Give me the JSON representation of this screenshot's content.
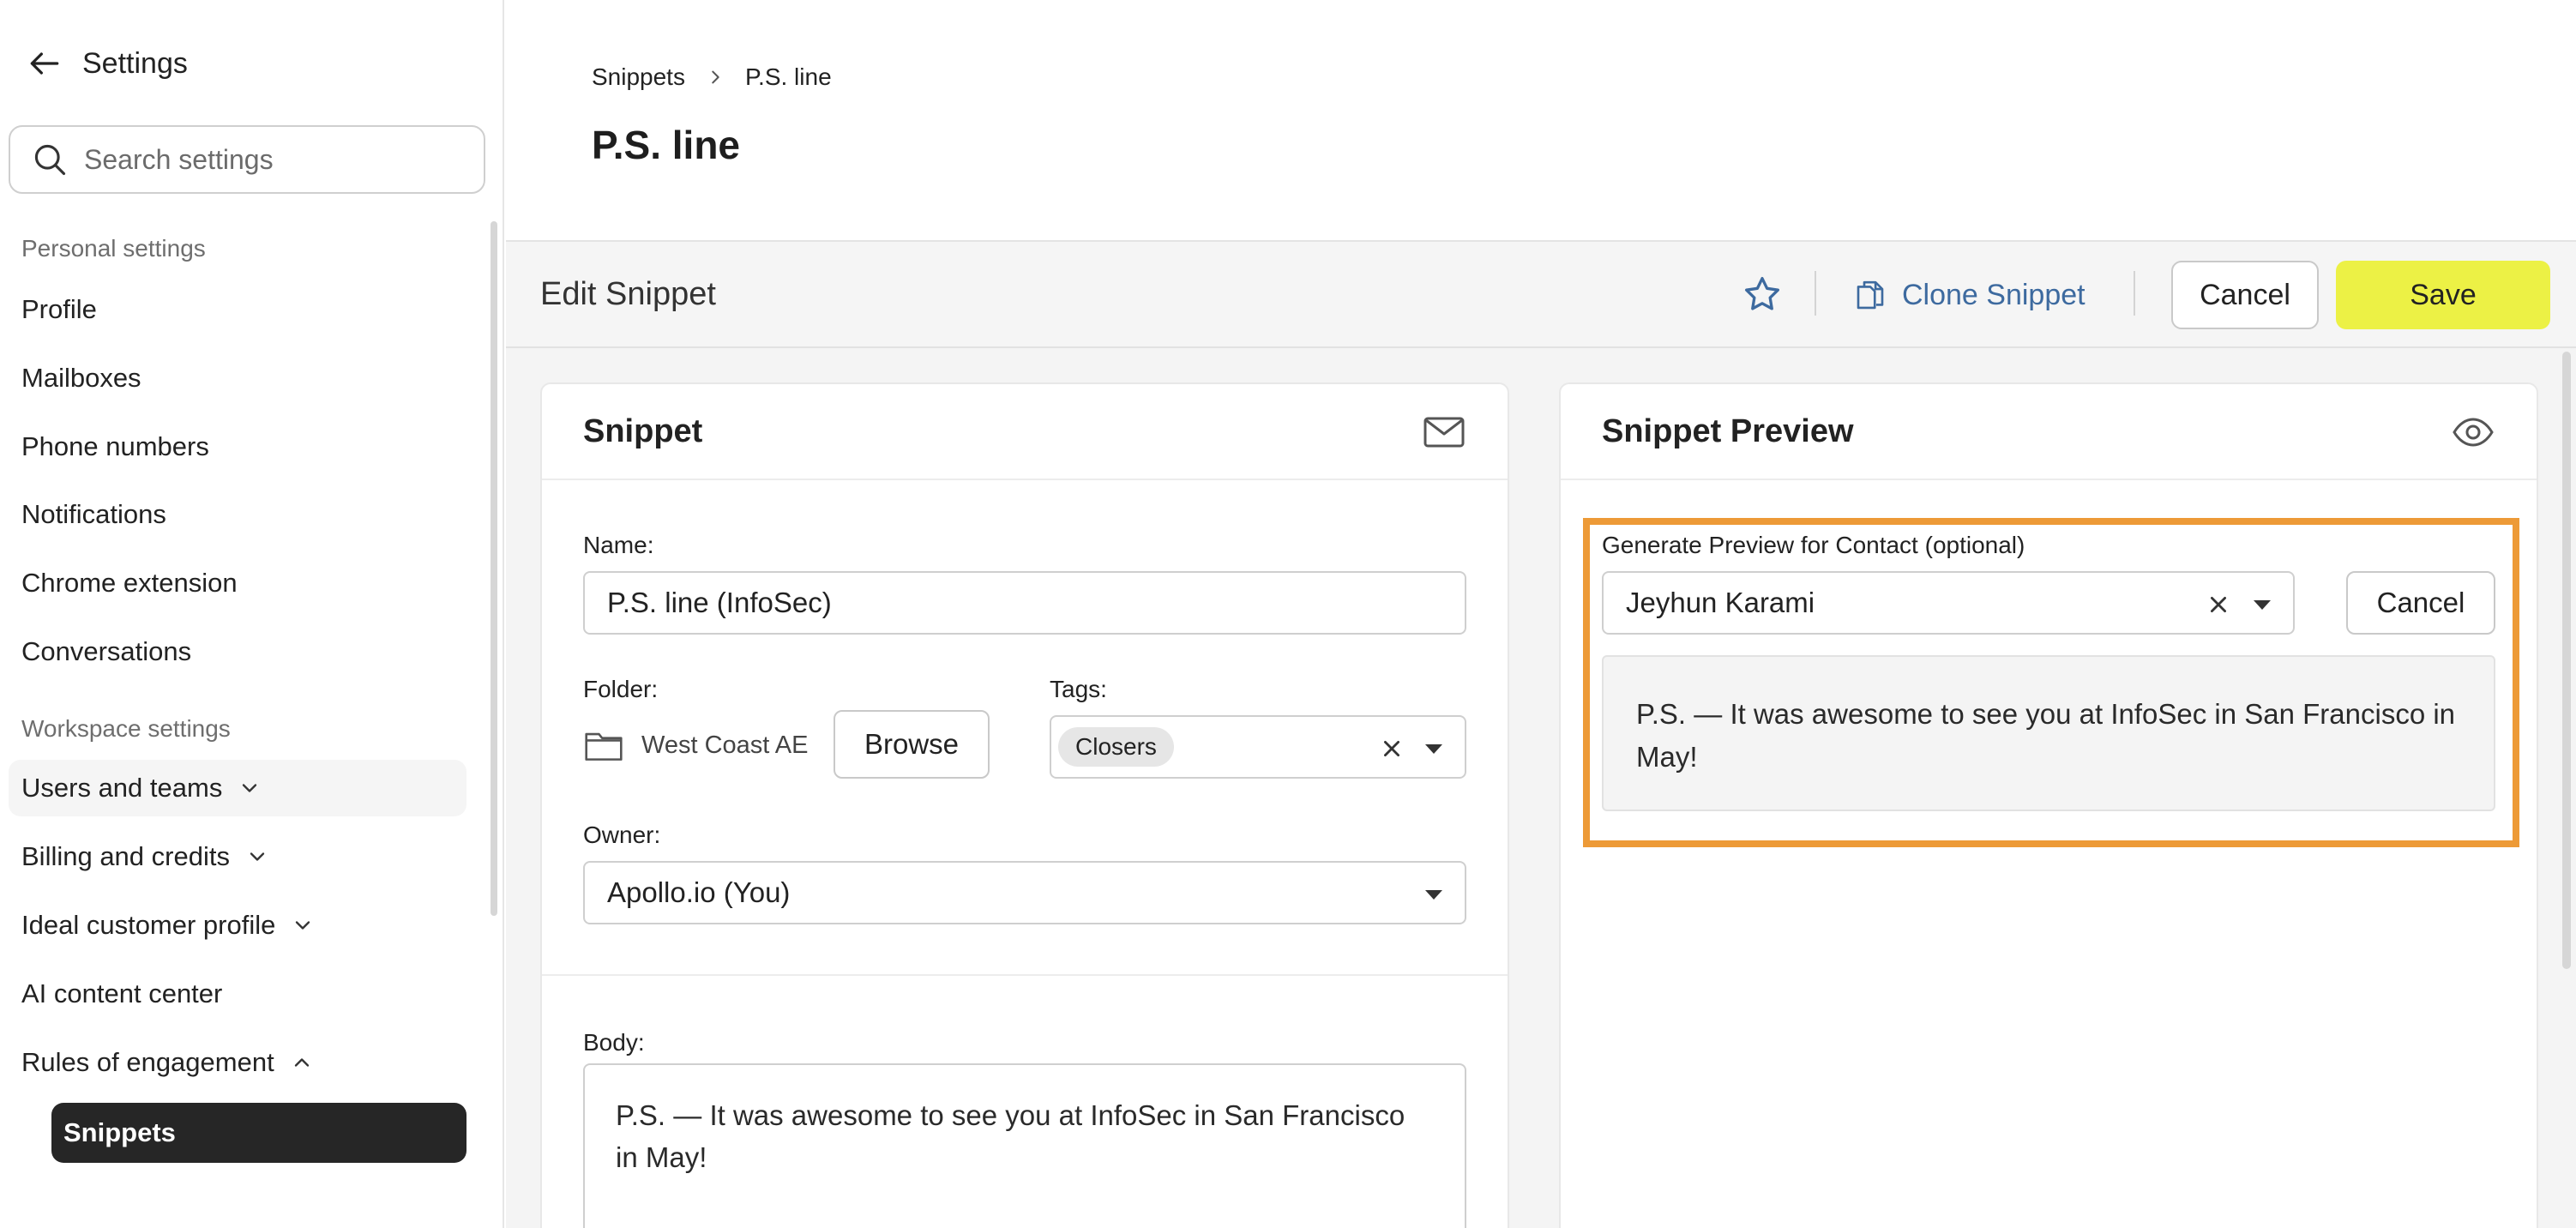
{
  "sidebar": {
    "back_label": "Settings",
    "search_placeholder": "Search settings",
    "personal_section": "Personal settings",
    "personal_items": [
      "Profile",
      "Mailboxes",
      "Phone numbers",
      "Notifications",
      "Chrome extension",
      "Conversations"
    ],
    "workspace_section": "Workspace settings",
    "workspace_items": [
      {
        "label": "Users and teams",
        "chevron": "down"
      },
      {
        "label": "Billing and credits",
        "chevron": "down"
      },
      {
        "label": "Ideal customer profile",
        "chevron": "down"
      },
      {
        "label": "AI content center",
        "chevron": ""
      },
      {
        "label": "Rules of engagement",
        "chevron": "up"
      }
    ],
    "active_item": "Snippets"
  },
  "breadcrumb": [
    "Snippets",
    "P.S. line"
  ],
  "page_title": "P.S. line",
  "toolbar": {
    "title": "Edit Snippet",
    "clone_label": "Clone Snippet",
    "cancel_label": "Cancel",
    "save_label": "Save"
  },
  "snippet_panel": {
    "title": "Snippet",
    "name_label": "Name:",
    "name_value": "P.S. line (InfoSec)",
    "folder_label": "Folder:",
    "folder_value": "West Coast AE",
    "browse_label": "Browse",
    "tags_label": "Tags:",
    "tag_value": "Closers",
    "owner_label": "Owner:",
    "owner_value": "Apollo.io (You)",
    "body_label": "Body:",
    "body_text": "P.S. — It was awesome to see you at InfoSec in San Francisco in May!"
  },
  "preview_panel": {
    "title": "Snippet Preview",
    "contact_label": "Generate Preview for Contact (optional)",
    "contact_value": "Jeyhun Karami",
    "cancel_label": "Cancel",
    "preview_text": "P.S. — It was awesome to see you at InfoSec in San Francisco in May!"
  },
  "colors": {
    "save_button": "#ecf145",
    "link_blue": "#3d6a9f",
    "highlight_border": "#ed9a37",
    "active_nav": "#262626"
  },
  "icons": [
    "arrow-left-icon",
    "search-icon",
    "chevron-down-icon",
    "chevron-up-icon",
    "chevron-right-icon",
    "star-icon",
    "copy-icon",
    "mail-icon",
    "eye-icon",
    "folder-icon",
    "clear-icon",
    "caret-down-icon"
  ]
}
